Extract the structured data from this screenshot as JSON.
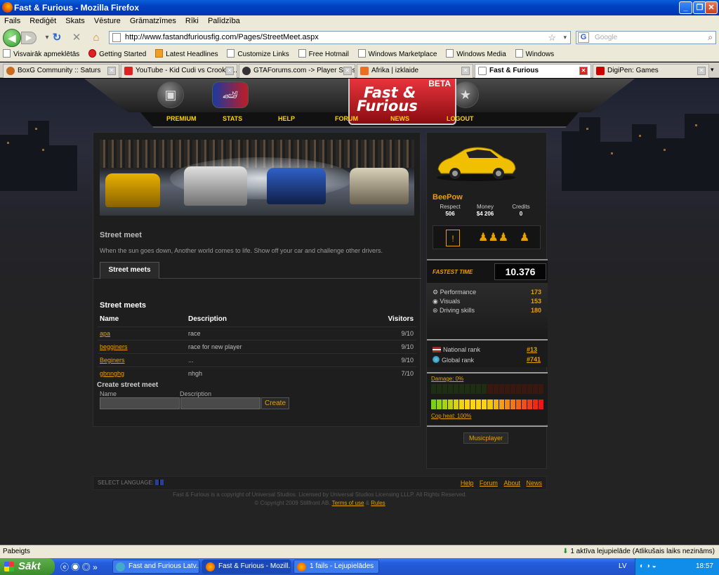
{
  "window": {
    "title": "Fast & Furious - Mozilla Firefox"
  },
  "menu": [
    "Fails",
    "Rediģēt",
    "Skats",
    "Vēsture",
    "Grāmatzīmes",
    "Rīki",
    "Palīdzība"
  ],
  "address": {
    "url": "http://www.fastandfuriousfig.com/Pages/StreetMeet.aspx",
    "search_placeholder": "Google"
  },
  "bookmarks": [
    "Visvairāk apmeklētās",
    "Getting Started",
    "Latest Headlines",
    "Customize Links",
    "Free Hotmail",
    "Windows Marketplace",
    "Windows Media",
    "Windows"
  ],
  "tabs": [
    {
      "label": "BoxG Community :: Saturs"
    },
    {
      "label": "YouTube - Kid Cudi vs Crooker..."
    },
    {
      "label": "GTAForums.com -> Player Skins"
    },
    {
      "label": "Afrika | izklaide"
    },
    {
      "label": "Fast & Furious"
    },
    {
      "label": "DigiPen: Games"
    }
  ],
  "site": {
    "logo_line1": "Fast &",
    "logo_line2": "Furious",
    "beta": "BETA",
    "nav": [
      "PREMIUM",
      "STATS",
      "HELP",
      "FORUM",
      "NEWS",
      "LOGOUT"
    ]
  },
  "main": {
    "section_title": "Street meet",
    "section_desc": "When the sun goes down, Another world comes to life. Show off your car and challenge other drivers.",
    "tab_label": "Street meets",
    "list_title": "Street meets",
    "columns": [
      "Name",
      "Description",
      "Visitors"
    ],
    "rows": [
      {
        "name": "apa",
        "desc": "race",
        "visitors": "9/10"
      },
      {
        "name": "begginers",
        "desc": "race for new player",
        "visitors": "9/10"
      },
      {
        "name": "Beginers",
        "desc": "...",
        "visitors": "9/10"
      },
      {
        "name": "gbnnghg",
        "desc": "nhgh",
        "visitors": "7/10"
      }
    ],
    "create_title": "Create street meet",
    "create_name_label": "Name",
    "create_desc_label": "Description",
    "create_button": "Create"
  },
  "sidebar": {
    "username": "BeePow",
    "stats": [
      {
        "label": "Respect",
        "value": "506"
      },
      {
        "label": "Money",
        "value": "$4 206"
      },
      {
        "label": "Credits",
        "value": "0"
      }
    ],
    "fastest_label": "FASTEST TIME",
    "fastest_value": "10.376",
    "skills": [
      {
        "label": "Performance",
        "value": "173"
      },
      {
        "label": "Visuals",
        "value": "153"
      },
      {
        "label": "Driving skills",
        "value": "180"
      }
    ],
    "national_rank_label": "National rank",
    "national_rank": "#13",
    "global_rank_label": "Global rank",
    "global_rank": "#741",
    "damage_label": "Damage: 0%",
    "damage_level": 0,
    "cop_heat_label": "Cop heat: 100%",
    "cop_heat_level": 1.0,
    "musicplayer": "Musicplayer"
  },
  "footer": {
    "select_language": "SELECT LANGUAGE:",
    "links": [
      "Help",
      "Forum",
      "About",
      "News"
    ],
    "copyright1": "Fast & Furious is a copyright of Universal Studios. Licensed by Universal Studios Licensing LLLP. All Rights Reserved.",
    "copyright2_prefix": "© Copyright 2009 Stillfront AB.",
    "terms": "Terms of use",
    "amp": "&",
    "rules": "Rules"
  },
  "statusbar": {
    "left": "Pabeigts",
    "right": "1 aktīva lejupielāde (Atlikušais laiks nezināms)"
  },
  "taskbar": {
    "start": "Sākt",
    "tasks": [
      "Fast and Furious Latv...",
      "Fast & Furious - Mozill...",
      "1 fails - Lejupielādes"
    ],
    "lang": "LV",
    "clock": "18:57"
  },
  "colors": {
    "accent": "#e8a000",
    "nav_yellow": "#ffd400",
    "logo_red": "#d8262e"
  }
}
